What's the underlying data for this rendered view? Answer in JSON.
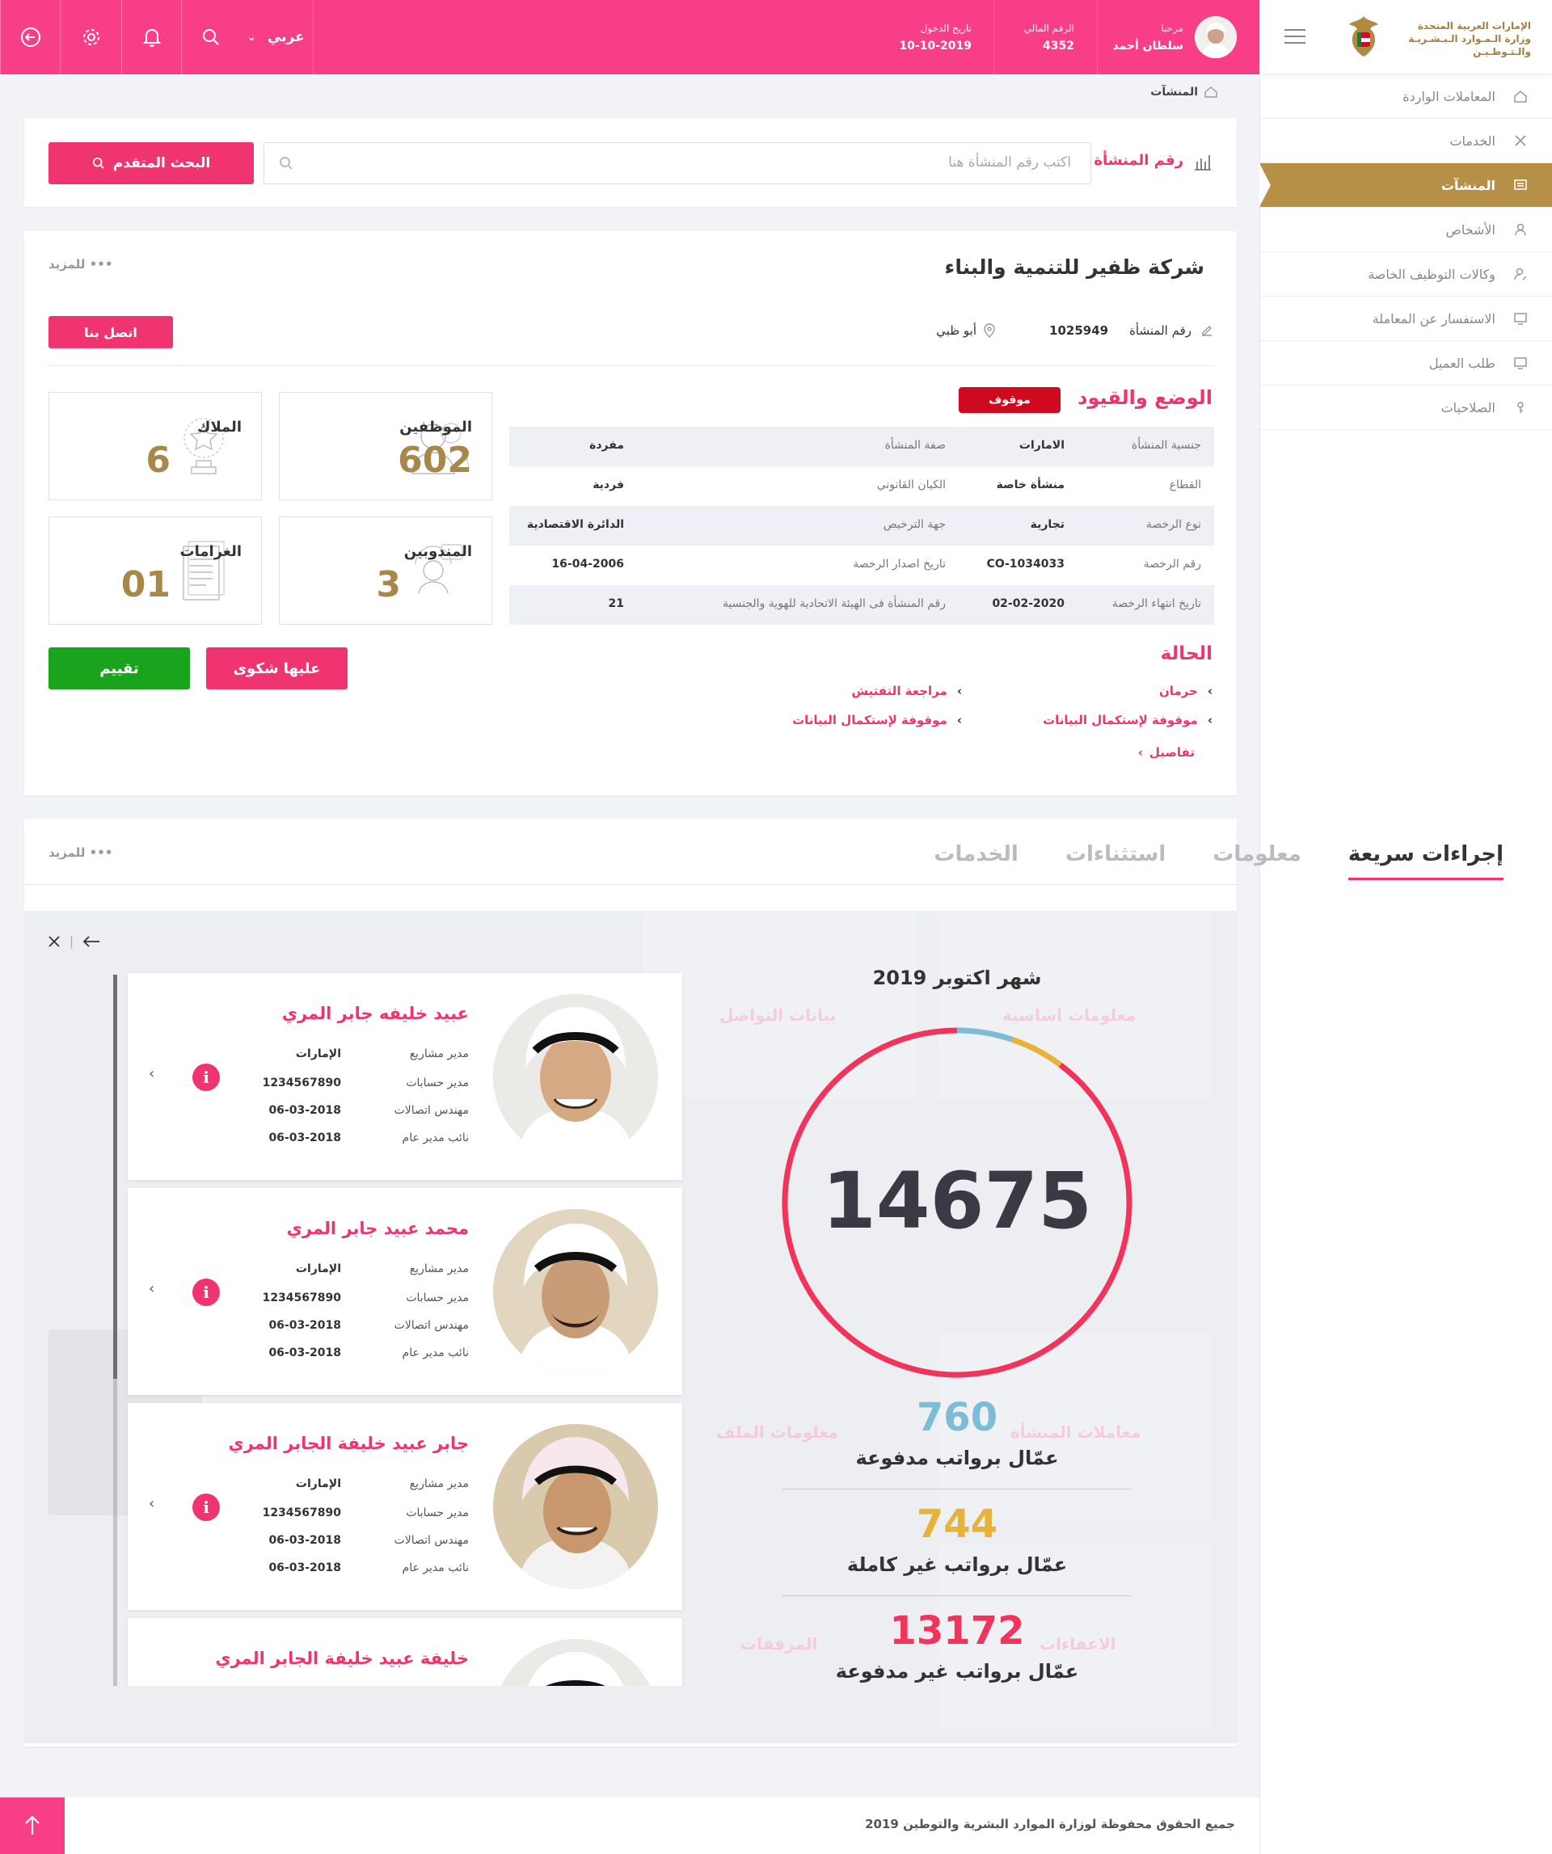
{
  "topbar": {
    "language": "عربي",
    "login_date_label": "تاريخ الدخول",
    "login_date": "10-10-2019",
    "personal_number_label": "الرقم المالي",
    "personal_number": "4352",
    "welcome_label": "مرحبا",
    "user_name": "سلطان أحمد"
  },
  "logo": {
    "line1": "الإمارات العربية المتحدة",
    "line2": "وزارة الـمـوارد الـبـشـريـة",
    "line3": "والـتـوطـيـن"
  },
  "sidebar": {
    "items": [
      {
        "label": "المعاملات الواردة",
        "icon": "home-icon"
      },
      {
        "label": "الخدمات",
        "icon": "tools-icon"
      },
      {
        "label": "المنشآت",
        "icon": "building-icon",
        "active": true
      },
      {
        "label": "الأشخاص",
        "icon": "person-icon"
      },
      {
        "label": "وكالات التوظيف الخاصة",
        "icon": "user-edit-icon"
      },
      {
        "label": "الاستفسار عن المعاملة",
        "icon": "monitor-icon"
      },
      {
        "label": "طلب العميل",
        "icon": "monitor-icon"
      },
      {
        "label": "الصلاحيات",
        "icon": "key-icon"
      }
    ]
  },
  "breadcrumb": "المنشآت",
  "search": {
    "label": "رقم المنشأة",
    "placeholder": "اكتب رقم المنشأة هنا",
    "advanced_button": "البحث المتقدم"
  },
  "company": {
    "name": "شركة ظفير للتنمية والبناء",
    "more": "للمزيد •••",
    "number_label": "رقم المنشأة",
    "number": "1025949",
    "location": "أبو ظبي",
    "contact_button": "اتصل بنا",
    "section_title": "الوضع والقيود",
    "status_badge": "موقوف",
    "table": [
      [
        "جنسية المنشأة",
        "الامارات",
        "صفة المنشأة",
        "مفردة"
      ],
      [
        "القطاع",
        "منشأة خاصة",
        "الكيان القانوني",
        "فردية"
      ],
      [
        "نوع الرخصة",
        "تجارية",
        "جهة الترخيص",
        "الدائرة الاقتصادية"
      ],
      [
        "رقم الرخصة",
        "CO-1034033",
        "تاريخ اصدار الرخصة",
        "16-04-2006"
      ],
      [
        "تاريخ انتهاء الرخصة",
        "02-02-2020",
        "رقم المنشأة فى الهيئة الاتحادية للهوية والجنسية",
        "21"
      ]
    ],
    "stats": {
      "employees_label": "الموظفين",
      "employees": "602",
      "owners_label": "الملاك",
      "owners": "6",
      "representatives_label": "المندوبين",
      "representatives": "3",
      "fines_label": "الغرامات",
      "fines": "01"
    },
    "status_title": "الحالة",
    "status_items": [
      "حرمان",
      "مراجعة التفتيش",
      "موقوفة لإستكمال البيانات",
      "موقوفة لإستكمال البيانات"
    ],
    "details_link": "تفاصيل",
    "complaint_button": "عليها شكوى",
    "rating_button": "تقييم"
  },
  "tabs": {
    "items": [
      "إجراءات سريعة",
      "معلومات",
      "استثناءات",
      "الخدمات"
    ],
    "more": "للمزيد •••"
  },
  "people": [
    {
      "name": "عبيد خليفه جابر المري",
      "r1l": "مدير مشاريع",
      "r1v": "الإمارات",
      "r2l": "مدير حسابات",
      "r2v": "1234567890",
      "r3l": "مهندس اتصالات",
      "r3v": "06-03-2018",
      "r4l": "نائب مدير عام",
      "r4v": "06-03-2018"
    },
    {
      "name": "محمد عبيد جابر المري",
      "r1l": "مدير مشاريع",
      "r1v": "الإمارات",
      "r2l": "مدير حسابات",
      "r2v": "1234567890",
      "r3l": "مهندس اتصالات",
      "r3v": "06-03-2018",
      "r4l": "نائب مدير عام",
      "r4v": "06-03-2018"
    },
    {
      "name": "جابر عبيد خليفة الجابر المري",
      "r1l": "مدير مشاريع",
      "r1v": "الإمارات",
      "r2l": "مدير حسابات",
      "r2v": "1234567890",
      "r3l": "مهندس اتصالات",
      "r3v": "06-03-2018",
      "r4l": "نائب مدير عام",
      "r4v": "06-03-2018"
    },
    {
      "name": "خليفة عبيد خليفة الجابر المري"
    }
  ],
  "chart_data": {
    "type": "pie",
    "title": "شهر اكتوبر 2019",
    "total": 14675,
    "series": [
      {
        "name": "عمّال برواتب مدفوعة",
        "value": 760,
        "color": "#7cbcd6"
      },
      {
        "name": "عمّال برواتب غير كاملة",
        "value": 744,
        "color": "#e6b23a"
      },
      {
        "name": "عمّال برواتب غير مدفوعة",
        "value": 13172,
        "color": "#f0345b"
      }
    ]
  },
  "background_tiles": [
    "معلومات اساسية",
    "بيانات التواصل",
    "معاملات المنشأة",
    "معلومات الملف",
    "الاعفاءات",
    "المرفقات"
  ],
  "footer": "جميع الحقوق محفوظة لوزارة الموارد البشرية والتوطين 2019"
}
